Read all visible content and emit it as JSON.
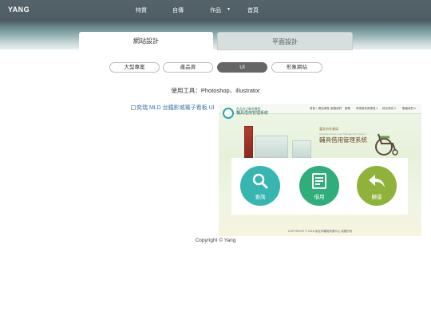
{
  "header": {
    "brand": "YANG",
    "nav": [
      "特質",
      "自傳",
      "作品",
      "首頁"
    ]
  },
  "tabs": [
    "網站設計",
    "平面設計"
  ],
  "pills": [
    "大型專案",
    "產品頁",
    "UI",
    "形象網站"
  ],
  "tools_text": "使用工具：Photoshop、illustrator",
  "broken_image_alt": "奕瑞 MLD 台鐵影城電子看板 UI",
  "screenshot": {
    "nav": [
      "首頁｜網站導覽",
      "認識我們",
      "服務",
      "申請與會員專區 ▾",
      "綜合資訊 ▾",
      "聯絡我們 ▾"
    ],
    "org_small": "台北市立聯合醫院",
    "org_big": "輔具借用管理系統",
    "title_small": "臺北市社會局",
    "title_subtitle": "Assistive Device Loan Management System",
    "title_large": "輔具借用管理系統",
    "buttons": [
      "查詢",
      "借用",
      "歸還"
    ],
    "copyright": "COPYRIGHT © 2018 臺北市輔具資源中心 版權所有"
  },
  "colors": {
    "query": "#37b5b0",
    "borrow": "#2fae7c",
    "return": "#8fb33a"
  },
  "footer": "Copyright © Yang"
}
